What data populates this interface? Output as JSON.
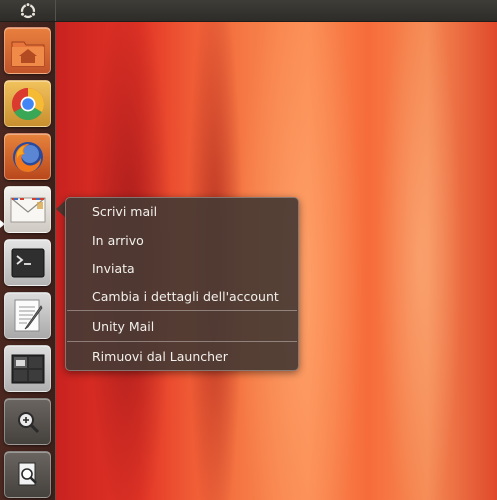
{
  "topbar": {
    "logo_icon": "ubuntu-logo-icon"
  },
  "launcher": {
    "items": [
      {
        "name": "home-folder",
        "icon": "home-folder-icon",
        "color": "#d86a3a"
      },
      {
        "name": "chrome",
        "icon": "chrome-icon",
        "color": "#e0b048"
      },
      {
        "name": "firefox",
        "icon": "firefox-icon",
        "color": "#d4682e"
      },
      {
        "name": "mail",
        "icon": "envelope-icon",
        "color": "#e8e6e2"
      },
      {
        "name": "terminal",
        "icon": "terminal-icon",
        "color": "#d8d8d8"
      },
      {
        "name": "text-editor",
        "icon": "text-editor-icon",
        "color": "#cfcfcf"
      },
      {
        "name": "workspace-switcher",
        "icon": "workspace-switcher-icon",
        "color": "#d4d4d4"
      },
      {
        "name": "magnifier",
        "icon": "magnifier-icon",
        "color": "#5a5550"
      },
      {
        "name": "document-viewer",
        "icon": "document-viewer-icon",
        "color": "#5a5550"
      }
    ]
  },
  "quicklist": {
    "items": [
      "Scrivi mail",
      "In arrivo",
      "Inviata",
      "Cambia i dettagli dell'account"
    ],
    "app_label": "Unity Mail",
    "remove_label": "Rimuovi dal Launcher"
  }
}
